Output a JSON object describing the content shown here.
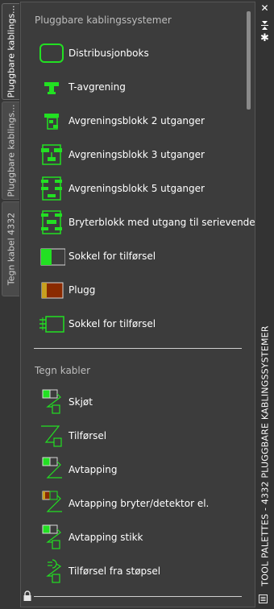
{
  "tabs": [
    {
      "label": "Pluggbare kablings..."
    },
    {
      "label": "Pluggbare kablings..."
    },
    {
      "label": "Tegn kabel 4332"
    }
  ],
  "palette_title": "TOOL PALETTES - 4332 PLUGGBARE KABLINGSSYSTEMER",
  "sections": [
    {
      "title": "Pluggbare kablingssystemer",
      "items": [
        {
          "label": "Distribusjonboks",
          "icon": "distribution-box-icon"
        },
        {
          "label": "T-avgrening",
          "icon": "t-branch-icon"
        },
        {
          "label": "Avgreningsblokk 2 utganger",
          "icon": "branch-block-2-icon"
        },
        {
          "label": "Avgreningsblokk 3 utganger",
          "icon": "branch-block-3-icon"
        },
        {
          "label": "Avgreningsblokk 5 utganger",
          "icon": "branch-block-5-icon"
        },
        {
          "label": "Bryterblokk med utgang til serievender",
          "icon": "switch-block-icon"
        },
        {
          "label": "Sokkel for tilførsel",
          "icon": "socket-supply-icon"
        },
        {
          "label": "Plugg",
          "icon": "plug-icon"
        },
        {
          "label": "Sokkel for tilførsel",
          "icon": "socket-supply-outline-icon"
        }
      ]
    },
    {
      "title": "Tegn kabler",
      "items": [
        {
          "label": "Skjøt",
          "icon": "joint-icon"
        },
        {
          "label": "Tilførsel",
          "icon": "supply-icon"
        },
        {
          "label": "Avtapping",
          "icon": "tap-icon"
        },
        {
          "label": "Avtapping bryter/detektor el.",
          "icon": "tap-switch-icon"
        },
        {
          "label": "Avtapping stikk",
          "icon": "tap-socket-icon"
        },
        {
          "label": "Tilførsel fra støpsel",
          "icon": "supply-from-plug-icon"
        }
      ]
    }
  ],
  "colors": {
    "accent_green": "#22e022",
    "plug_red": "#8a2a00"
  }
}
